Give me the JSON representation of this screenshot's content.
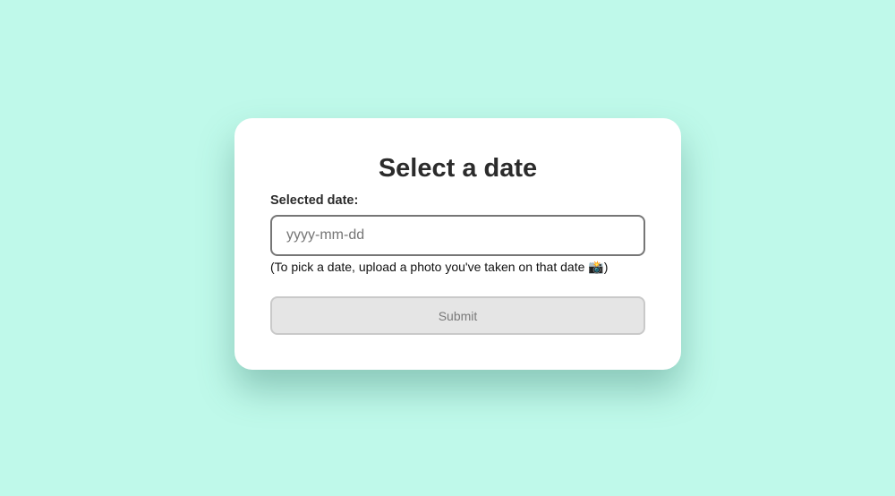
{
  "colors": {
    "background": "#bff9ea",
    "card": "#ffffff",
    "button_disabled_bg": "#e5e5e5"
  },
  "form": {
    "title": "Select a date",
    "date_label": "Selected date:",
    "date_value": "",
    "date_placeholder": "yyyy-mm-dd",
    "hint": "(To pick a date, upload a photo you've taken on that date 📸)",
    "submit_label": "Submit",
    "submit_disabled": true
  }
}
